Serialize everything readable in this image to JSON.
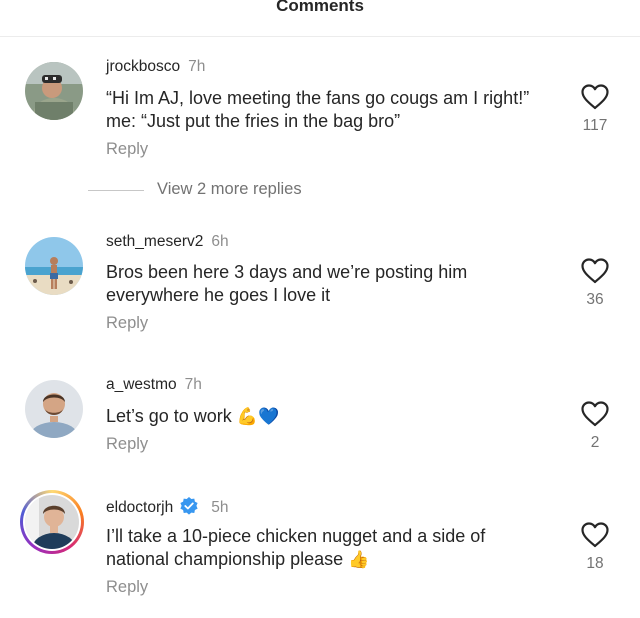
{
  "header": {
    "title": "Comments"
  },
  "comments": [
    {
      "username": "jrockbosco",
      "time": "7h",
      "text_lines": [
        "“Hi Im AJ, love meeting the fans go cougs am I right!”",
        "me: “Just put the fries in the bag bro”"
      ],
      "reply_label": "Reply",
      "likes": "117",
      "more_replies": "View 2 more replies"
    },
    {
      "username": "seth_meserv2",
      "time": "6h",
      "text_lines": [
        "Bros been here 3 days and we’re posting him",
        "everywhere he goes I love it"
      ],
      "reply_label": "Reply",
      "likes": "36"
    },
    {
      "username": "a_westmo",
      "time": "7h",
      "text_lines": [
        "Let’s go to work"
      ],
      "emojis": [
        "💪",
        "💙"
      ],
      "reply_label": "Reply",
      "likes": "2"
    },
    {
      "username": "eldoctorjh",
      "time": "5h",
      "verified": true,
      "text_lines": [
        "I’ll take a 10-piece chicken nugget and a side of",
        "national championship please"
      ],
      "emojis": [
        "👍"
      ],
      "reply_label": "Reply",
      "likes": "18"
    }
  ],
  "colors": {
    "text": "#262626",
    "muted": "#8e8e8e",
    "verified": "#3897f0"
  }
}
